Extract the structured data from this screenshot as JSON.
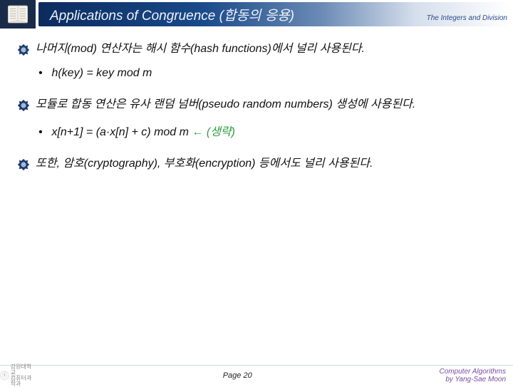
{
  "header": {
    "title": "Applications of Congruence (합동의 응용)",
    "section": "The Integers and Division"
  },
  "content": {
    "b1": "나머지(mod) 연산자는 해시 함수(hash functions)에서 널리 사용된다.",
    "s1": "h(key) = key mod m",
    "b2": "모듈로 합동 연산은 유사 랜덤 넘버(pseudo random numbers) 생성에 사용된다.",
    "s2_main": "x[n+1] = (a·x[n] + c) mod m  ",
    "s2_arrow": "←",
    "s2_note": " (생략)",
    "b3": "또한, 암호(cryptography), 부호화(encryption) 등에서도 널리 사용된다."
  },
  "footer": {
    "page": "Page 20",
    "credit1": "Computer Algorithms",
    "credit2": "by Yang-Sae Moon"
  }
}
